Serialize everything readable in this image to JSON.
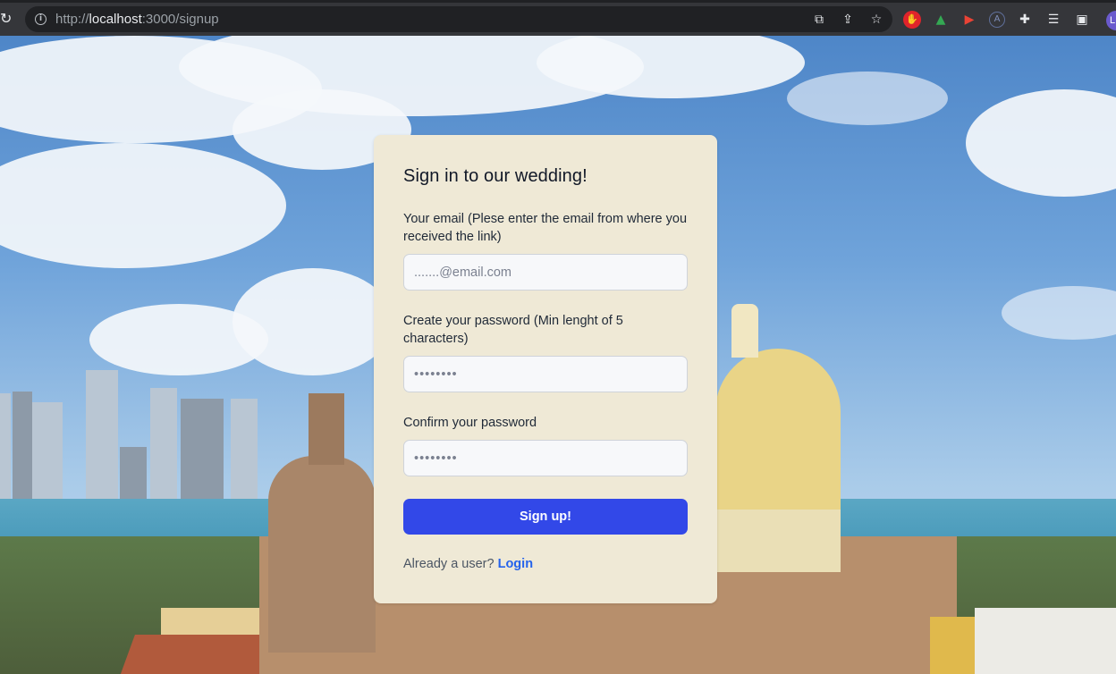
{
  "browser": {
    "url_scheme": "http://",
    "url_host": "localhost",
    "url_path": ":3000/signup",
    "reload_icon": "reload-icon",
    "info_icon": "info-icon",
    "omnibox_icons": [
      "open-external-icon",
      "share-icon",
      "star-icon"
    ],
    "extension_icons": [
      "adblock-icon",
      "google-drive-icon",
      "video-extension-icon",
      "a-extension-icon",
      "puzzle-extensions-icon",
      "reading-list-icon",
      "sidebar-icon"
    ],
    "avatar_letter": "L"
  },
  "card": {
    "background": "#efe9d6",
    "title": "Sign in to our wedding!",
    "email_label": "Your email (Plese enter the email from where you received the link)",
    "email_placeholder": ".......@email.com",
    "password_label": "Create your password (Min lenght of 5 characters)",
    "password_placeholder": "••••••••",
    "confirm_label": "Confirm your password",
    "confirm_placeholder": "••••••••",
    "submit_label": "Sign up!",
    "submit_color": "#3248e8",
    "footer_text": "Already a user?",
    "login_link": "Login",
    "link_color": "#2563eb"
  }
}
